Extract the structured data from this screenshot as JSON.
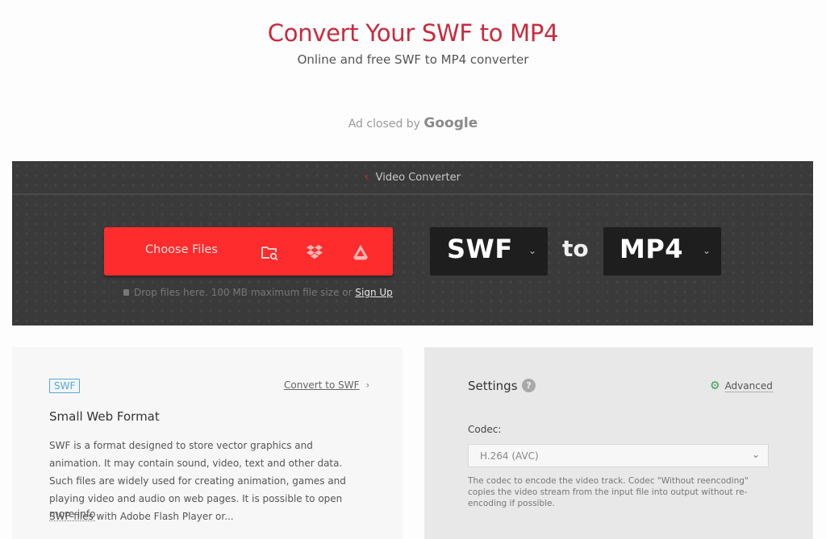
{
  "hero": {
    "title": "Convert Your SWF to MP4",
    "subtitle": "Online and free SWF to MP4 converter"
  },
  "ad": {
    "text": "Ad closed by",
    "brand": "Google"
  },
  "converter": {
    "breadcrumb": {
      "back_icon": "chevron-left-icon",
      "label": "Video Converter"
    },
    "choose_files": {
      "label": "Choose Files",
      "icons": [
        "folder-search-icon",
        "dropbox-icon",
        "google-drive-icon"
      ],
      "color": "#fe2c2c"
    },
    "drop_hint": {
      "text": "Drop files here. 100 MB maximum file size or",
      "link": "Sign Up"
    },
    "from_format": "SWF",
    "to_label": "to",
    "to_format": "MP4"
  },
  "format_info": {
    "badge": "SWF",
    "convert_link": "Convert to SWF",
    "name": "Small Web Format",
    "description": "SWF is a format designed to store vector graphics and animation. It may contain sound, video, text and other data. Such files are widely used for creating animation, games and playing video and audio on web pages. It is possible to open SWF files with Adobe Flash Player or...",
    "more_info": "more info"
  },
  "settings": {
    "title": "Settings",
    "help_icon": "?",
    "advanced_label": "Advanced",
    "codec_label": "Codec:",
    "codec_value": "H.264 (AVC)",
    "codec_help": "The codec to encode the video track. Codec \"Without reencoding\" copies the video stream from the input file into output without re-encoding if possible."
  }
}
